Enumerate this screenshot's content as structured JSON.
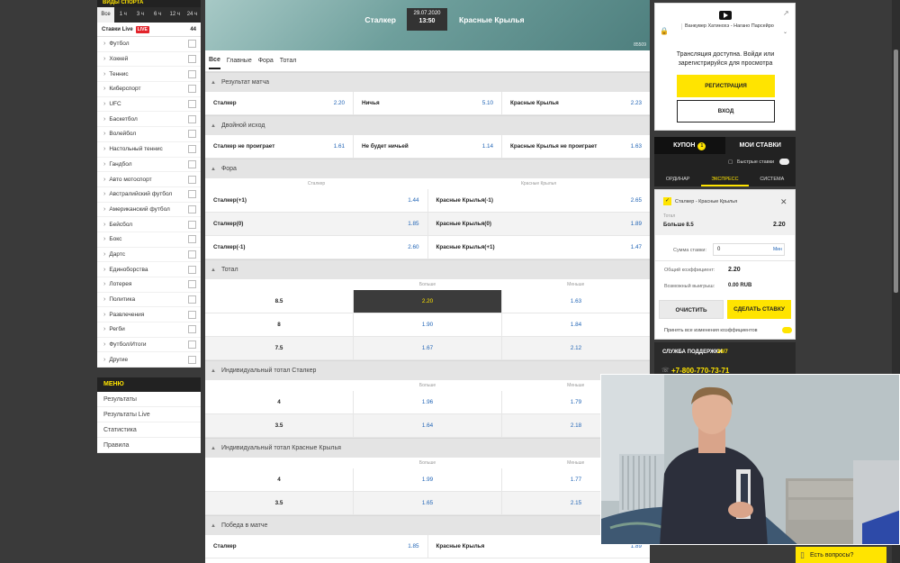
{
  "left": {
    "header": "ВИДЫ СПОРТА",
    "time_filters": [
      "Все",
      "1 ч",
      "3 ч",
      "6 ч",
      "12 ч",
      "24 ч"
    ],
    "live": {
      "label": "Ставки Live",
      "badge": "LIVE",
      "count": "44"
    },
    "sports": [
      "Футбол",
      "Хоккей",
      "Теннис",
      "Киберспорт",
      "UFC",
      "Баскетбол",
      "Волейбол",
      "Настольный теннис",
      "Гандбол",
      "Авто мотоспорт",
      "Австралийский футбол",
      "Американский футбол",
      "Бейсбол",
      "Бокс",
      "Дартс",
      "Единоборства",
      "Лотерея",
      "Политика",
      "Развлечения",
      "Регби",
      "Футбол/Итоги",
      "Другие"
    ],
    "menu_title": "МЕНЮ",
    "menu": [
      "Результаты",
      "Результаты Live",
      "Статистика",
      "Правила"
    ]
  },
  "event": {
    "team1": "Сталкер",
    "team2": "Красные Крылья",
    "date": "29.07.2020",
    "time": "13:50",
    "id": "85509",
    "tabs": [
      "Все",
      "Главные",
      "Фора",
      "Тотал"
    ]
  },
  "markets": {
    "result": {
      "title": "Результат матча",
      "cells": [
        [
          "Сталкер",
          "2.20"
        ],
        [
          "Ничья",
          "5.10"
        ],
        [
          "Красные Крылья",
          "2.23"
        ]
      ]
    },
    "double": {
      "title": "Двойной исход",
      "cells": [
        [
          "Сталкер не проиграет",
          "1.61"
        ],
        [
          "Не будет ничьей",
          "1.14"
        ],
        [
          "Красные Крылья не проиграет",
          "1.63"
        ]
      ]
    },
    "handicap": {
      "title": "Фора",
      "col1": "Сталкер",
      "col2": "Красные Крылья",
      "rows": [
        [
          [
            "Сталкер(+1)",
            "1.44"
          ],
          [
            "Красные Крылья(-1)",
            "2.65"
          ]
        ],
        [
          [
            "Сталкер(0)",
            "1.85"
          ],
          [
            "Красные Крылья(0)",
            "1.89"
          ]
        ],
        [
          [
            "Сталкер(-1)",
            "2.60"
          ],
          [
            "Красные Крылья(+1)",
            "1.47"
          ]
        ]
      ]
    },
    "total": {
      "title": "Тотал",
      "more": "Больше",
      "less": "Меньше",
      "rows": [
        [
          "8.5",
          "2.20",
          "1.63"
        ],
        [
          "8",
          "1.90",
          "1.84"
        ],
        [
          "7.5",
          "1.67",
          "2.12"
        ]
      ]
    },
    "ind1": {
      "title": "Индивидуальный тотал Сталкер",
      "more": "Больше",
      "less": "Меньше",
      "rows": [
        [
          "4",
          "1.96",
          "1.79"
        ],
        [
          "3.5",
          "1.64",
          "2.18"
        ]
      ]
    },
    "ind2": {
      "title": "Индивидуальный тотал Красные Крылья",
      "more": "Больше",
      "less": "Меньше",
      "rows": [
        [
          "4",
          "1.99",
          "1.77"
        ],
        [
          "3.5",
          "1.65",
          "2.15"
        ]
      ]
    },
    "win": {
      "title": "Победа в матче",
      "cells": [
        [
          "Сталкер",
          "1.85"
        ],
        [
          "Красные Крылья",
          "1.89"
        ]
      ]
    }
  },
  "right": {
    "stream_match": "Ванкувер Хатинохэ - Нагано Парсейро",
    "stream_text": "Трансляция доступна. Войди или зарегистрируйся для просмотра",
    "register": "РЕГИСТРАЦИЯ",
    "login": "ВХОД",
    "coupon_tab": "КУПОН",
    "coupon_count": "1",
    "mybets_tab": "МОИ СТАВКИ",
    "fast_bets": "Быстрые ставки",
    "bet_types": [
      "ОРДИНАР",
      "ЭКСПРЕСС",
      "СИСТЕМА"
    ],
    "bet_event": "Сталкер - Красные Крылья",
    "bet_market": "Тотал",
    "bet_outcome": "Больше 8.5",
    "bet_odd": "2.20",
    "stake_label": "Сумма ставки:",
    "stake_value": "0",
    "stake_min": "Мин",
    "total_coef_label": "Общий коэффициент:",
    "total_coef": "2.20",
    "win_label": "Возможный выигрыш:",
    "win_value": "0.00 RUB",
    "clear_btn": "ОЧИСТИТЬ",
    "place_btn": "СДЕЛАТЬ СТАВКУ",
    "accept_label": "Принять все изменения коэффициентов",
    "support_label": "СЛУЖБА ПОДДЕРЖКИ",
    "support_hours": "24/7",
    "support_phone": "+7-800-770-73-71"
  },
  "chat": "Есть вопросы?",
  "colors": {
    "accent": "#ffe400",
    "odds": "#1f63b5",
    "dark": "#222222",
    "live": "#e3242b"
  }
}
